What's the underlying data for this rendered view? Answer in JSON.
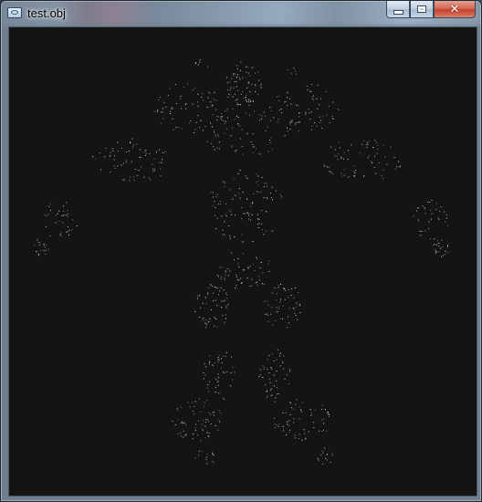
{
  "window": {
    "title": "test.obj",
    "icon": "app-window-icon",
    "controls": {
      "minimize_icon": "minimize-icon",
      "maximize_icon": "maximize-icon",
      "close_label": "✕"
    }
  },
  "viewport": {
    "background": "#141414",
    "point_color": "#e6e6e6",
    "content": "point-cloud-humanoid"
  }
}
